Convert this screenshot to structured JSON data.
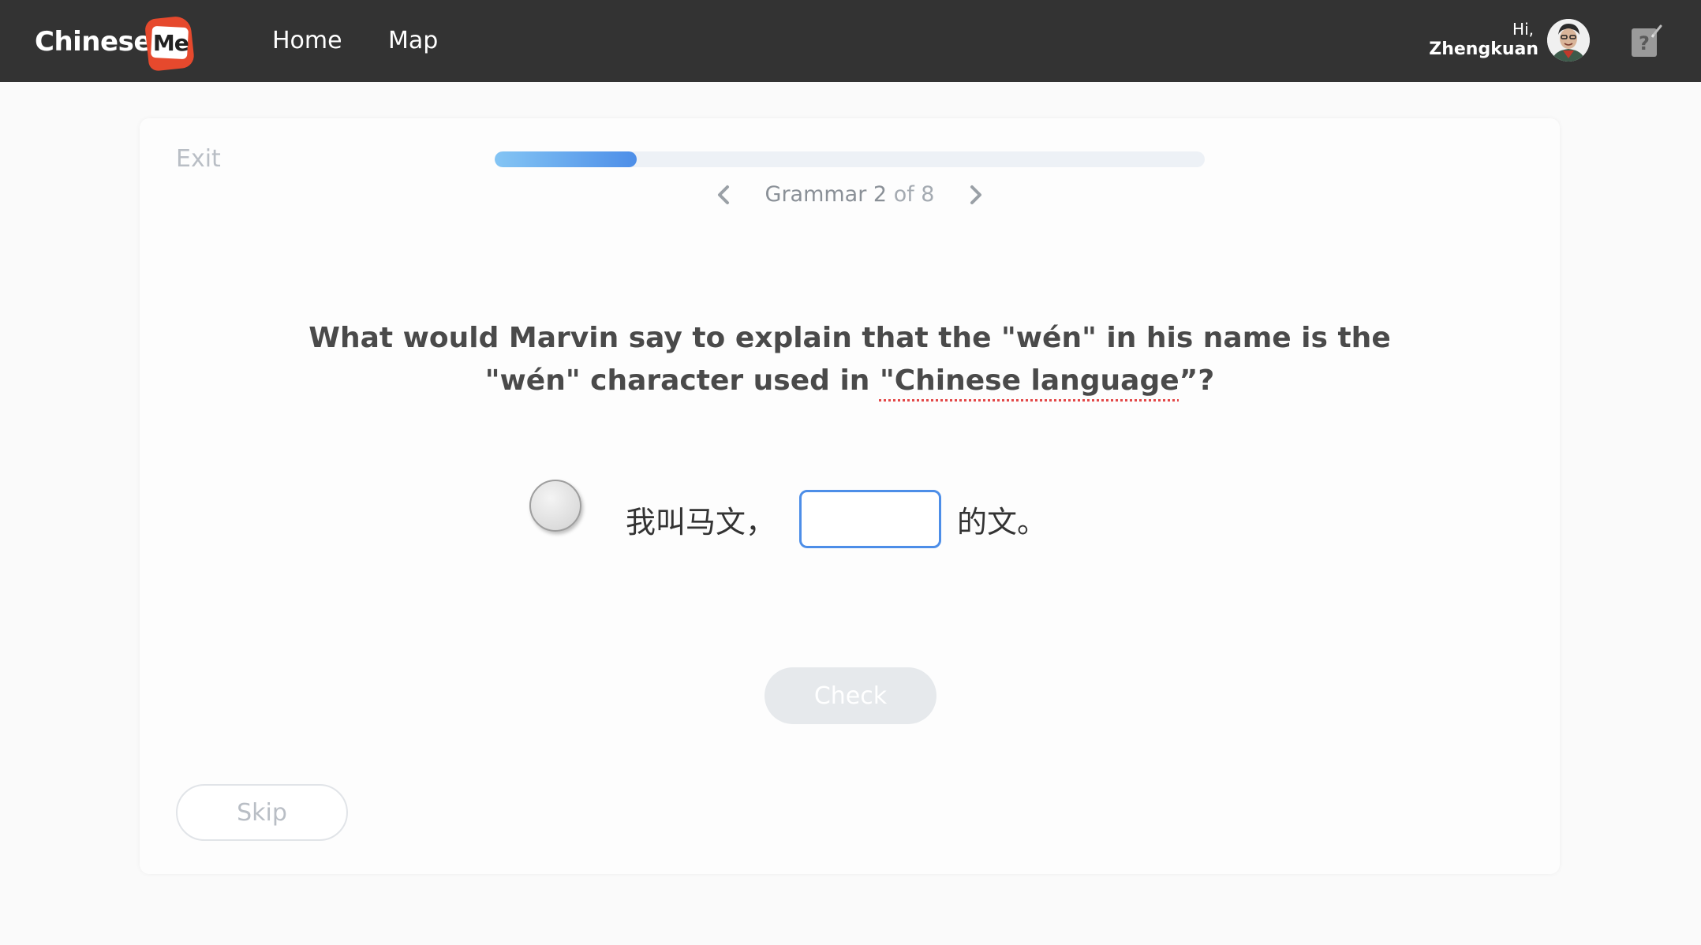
{
  "header": {
    "logo": {
      "text": "Chinese",
      "badge_text": "Me"
    },
    "nav": [
      {
        "label": "Home"
      },
      {
        "label": "Map"
      }
    ],
    "user": {
      "greeting": "Hi,",
      "name": "Zhengkuan"
    },
    "icons": {
      "avatar": "user-avatar",
      "help": "help-notepad-icon"
    }
  },
  "lesson": {
    "exit_label": "Exit",
    "progress": {
      "current": 2,
      "total": 8,
      "fraction": 0.2
    },
    "step_name": "Grammar 2",
    "step_of": "of 8",
    "question_part1": "What would Marvin say to explain that the \"wén\" in his name is the \"wén\" character used in ",
    "question_highlight": "\"Chinese language",
    "question_end": "”?",
    "sentence_before": "我叫马文，",
    "sentence_after": "的文。",
    "answer_value": "",
    "check_label": "Check",
    "skip_label": "Skip"
  },
  "colors": {
    "topbar": "#333333",
    "accent": "#4d8ee8",
    "logo_red": "#e6492d",
    "spell_underline": "#e34848"
  }
}
